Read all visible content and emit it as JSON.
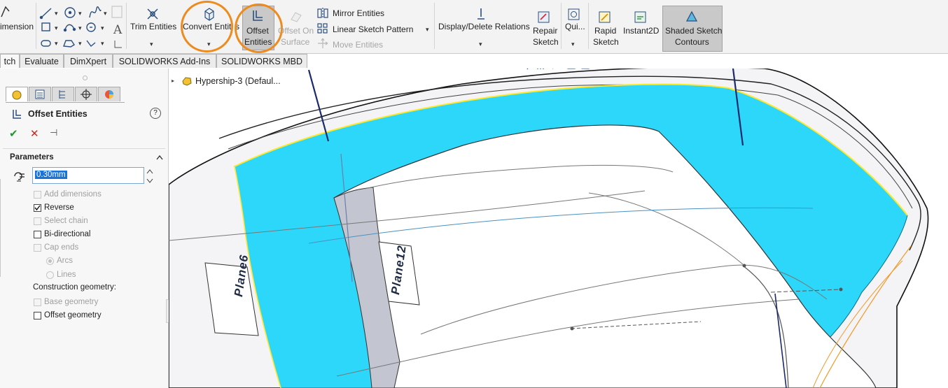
{
  "ribbon": {
    "dimension_label": "imension",
    "trim_label": "Trim Entities",
    "convert_label": "Convert Entiti",
    "s_fragment": "s",
    "offset_label_1": "Offset",
    "offset_label_2": "Entities",
    "offset_surface_1": "Offset On",
    "offset_surface_2": "Surface",
    "mirror_label": "Mirror Entities",
    "linear_pattern_label": "Linear Sketch Pattern",
    "move_label": "Move Entities",
    "relations_label": "Display/Delete Relations",
    "repair_label_1": "Repair",
    "repair_label_2": "Sketch",
    "quick_label": "Qui...",
    "rapid_label_1": "Rapid",
    "rapid_label_2": "Sketch",
    "instant2d_label": "Instant2D",
    "shaded_label_1": "Shaded Sketch",
    "shaded_label_2": "Contours"
  },
  "tabs": [
    "tch",
    "Evaluate",
    "DimXpert",
    "SOLIDWORKS Add-Ins",
    "SOLIDWORKS MBD"
  ],
  "tree": {
    "item_label": "Hypership-3  (Defaul..."
  },
  "pm": {
    "title": "Offset Entities",
    "help_glyph": "?",
    "ok_glyph": "✔",
    "cancel_glyph": "✕",
    "pin_glyph": "⊣",
    "section_title": "Parameters",
    "offset_value": "0.30mm",
    "options": {
      "add_dimensions": "Add dimensions",
      "reverse": "Reverse",
      "select_chain": "Select chain",
      "bidirectional": "Bi-directional",
      "cap_ends": "Cap ends",
      "arcs": "Arcs",
      "lines": "Lines"
    },
    "construction_label": "Construction geometry:",
    "base_geometry": "Base geometry",
    "offset_geometry": "Offset geometry"
  },
  "viewport": {
    "plane_a": "Plane6",
    "plane_b": "Plane12"
  },
  "colors": {
    "highlight_face": "#2dd7f9",
    "callout_ring": "#ed8b1f",
    "selected_edge": "#ffe82a"
  }
}
